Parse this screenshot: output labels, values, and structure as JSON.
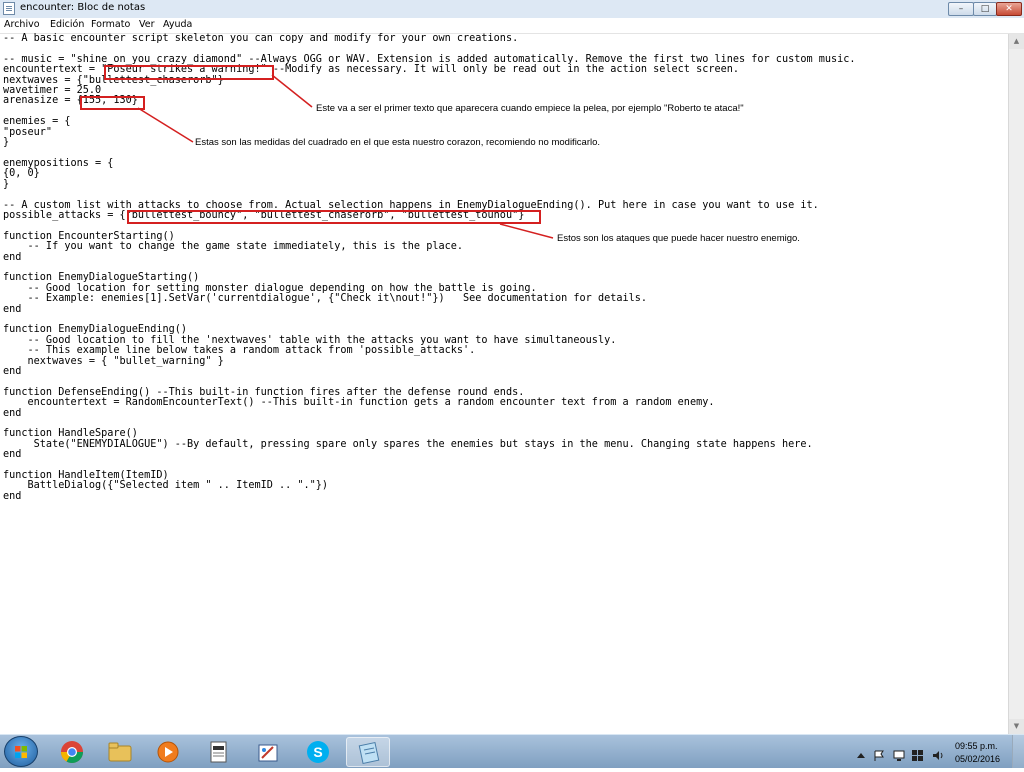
{
  "window": {
    "title": "encounter: Bloc de notas",
    "minimize_glyph": "–",
    "maximize_glyph": "□",
    "close_glyph": "✕"
  },
  "menu": {
    "archivo": "Archivo",
    "edicion": "Edición",
    "formato": "Formato",
    "ver": "Ver",
    "ayuda": "Ayuda"
  },
  "editor": {
    "content": "-- A basic encounter script skeleton you can copy and modify for your own creations.\n\n-- music = \"shine_on_you_crazy_diamond\" --Always OGG or WAV. Extension is added automatically. Remove the first two lines for custom music.\nencountertext = \"Poseur strikes a warning!\" --Modify as necessary. It will only be read out in the action select screen.\nnextwaves = {\"bullettest_chaserorb\"}\nwavetimer = 25.0\narenasize = {155, 130}\n\nenemies = {\n\"poseur\"\n}\n\nenemypositions = {\n{0, 0}\n}\n\n-- A custom list with attacks to choose from. Actual selection happens in EnemyDialogueEnding(). Put here in case you want to use it.\npossible_attacks = {\"bullettest_bouncy\", \"bullettest_chaserorb\", \"bullettest_touhou\"}\n\nfunction EncounterStarting()\n    -- If you want to change the game state immediately, this is the place.\nend\n\nfunction EnemyDialogueStarting()\n    -- Good location for setting monster dialogue depending on how the battle is going.\n    -- Example: enemies[1].SetVar('currentdialogue', {\"Check it\\nout!\"})   See documentation for details.\nend\n\nfunction EnemyDialogueEnding()\n    -- Good location to fill the 'nextwaves' table with the attacks you want to have simultaneously.\n    -- This example line below takes a random attack from 'possible_attacks'.\n    nextwaves = { \"bullet_warning\" }\nend\n\nfunction DefenseEnding() --This built-in function fires after the defense round ends.\n    encountertext = RandomEncounterText() --This built-in function gets a random encounter text from a random enemy.\nend\n\nfunction HandleSpare()\n     State(\"ENEMYDIALOGUE\") --By default, pressing spare only spares the enemies but stays in the menu. Changing state happens here.\nend\n\nfunction HandleItem(ItemID)\n    BattleDialog({\"Selected item \" .. ItemID .. \".\"})\nend"
  },
  "annotations": {
    "encountertext_note": "Este va a ser el primer texto que aparecera cuando empiece la pelea, por ejemplo \"Roberto te ataca!\"",
    "arenasize_note": "Estas son las medidas del cuadrado en el que esta nuestro corazon, recomiendo no modificarlo.",
    "attacks_note": "Estos son los ataques que puede hacer nuestro enemigo.",
    "highlight_color": "#d42020"
  },
  "taskbar": {
    "apps": [
      "chrome-icon",
      "file-explorer-icon",
      "media-player-icon",
      "notepad-document-icon",
      "paint-icon",
      "skype-icon",
      "notepad-icon"
    ],
    "clock_time": "09:55 p.m.",
    "clock_date": "05/02/2016"
  }
}
